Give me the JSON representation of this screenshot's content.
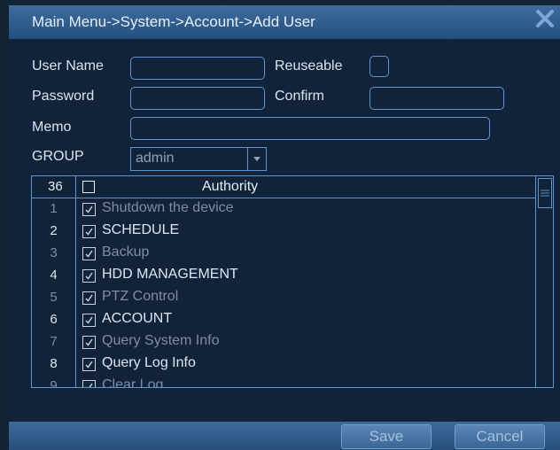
{
  "window": {
    "title": "Main Menu->System->Account->Add User"
  },
  "form": {
    "user_name_label": "User Name",
    "user_name_value": "",
    "reuseable_label": "Reuseable",
    "reuseable_checked": false,
    "password_label": "Password",
    "password_value": "",
    "confirm_label": "Confirm",
    "confirm_value": "",
    "memo_label": "Memo",
    "memo_value": "",
    "group_label": "GROUP",
    "group_value": "admin"
  },
  "authority": {
    "count": "36",
    "header": "Authority",
    "rows": [
      {
        "num": "1",
        "label": "Shutdown the device",
        "checked": true
      },
      {
        "num": "2",
        "label": "SCHEDULE",
        "checked": true
      },
      {
        "num": "3",
        "label": "Backup",
        "checked": true
      },
      {
        "num": "4",
        "label": "HDD MANAGEMENT",
        "checked": true
      },
      {
        "num": "5",
        "label": "PTZ Control",
        "checked": true
      },
      {
        "num": "6",
        "label": "ACCOUNT",
        "checked": true
      },
      {
        "num": "7",
        "label": "Query System Info",
        "checked": true
      },
      {
        "num": "8",
        "label": "Query Log Info",
        "checked": true
      },
      {
        "num": "9",
        "label": "Clear Log",
        "checked": true
      }
    ]
  },
  "buttons": {
    "save": "Save",
    "cancel": "Cancel"
  },
  "colors": {
    "accent": "#5d95d1",
    "title_bar": "#3f6c9d",
    "background": "#112338"
  }
}
